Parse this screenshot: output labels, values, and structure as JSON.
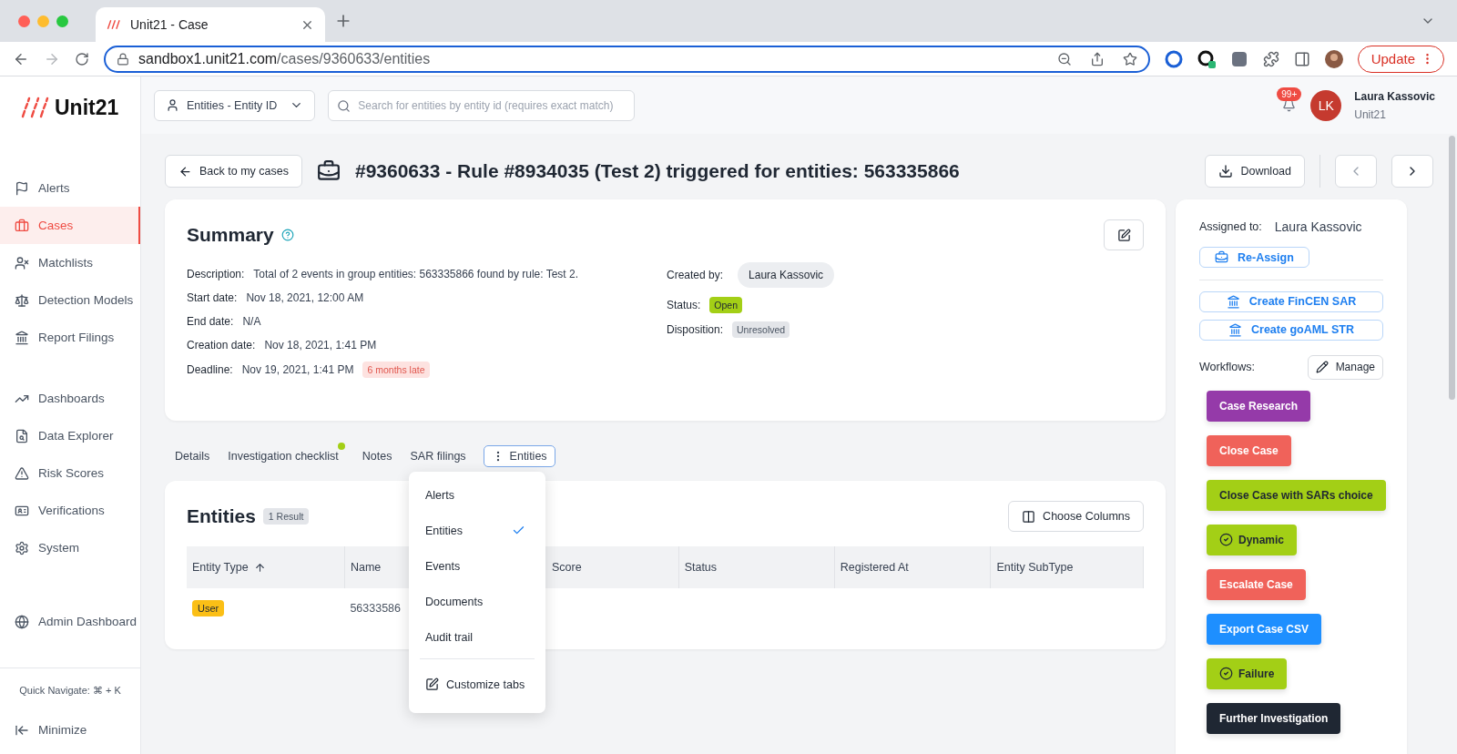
{
  "browser": {
    "tab_title": "Unit21 - Case",
    "url_host": "sandbox1.unit21.com",
    "url_path": "/cases/9360633/entities",
    "update_label": "Update"
  },
  "sidebar": {
    "logo": "Unit21",
    "groups": [
      [
        {
          "label": "Alerts",
          "selected": false
        },
        {
          "label": "Cases",
          "selected": true
        },
        {
          "label": "Matchlists",
          "selected": false
        },
        {
          "label": "Detection Models",
          "selected": false
        },
        {
          "label": "Report Filings",
          "selected": false
        }
      ],
      [
        {
          "label": "Dashboards",
          "selected": false
        },
        {
          "label": "Data Explorer",
          "selected": false
        },
        {
          "label": "Risk Scores",
          "selected": false
        },
        {
          "label": "Verifications",
          "selected": false
        },
        {
          "label": "System",
          "selected": false
        }
      ],
      [
        {
          "label": "Admin Dashboard",
          "selected": false
        }
      ]
    ],
    "quick_navigate": "Quick Navigate: ⌘ + K",
    "minimize": "Minimize"
  },
  "header": {
    "search_type": "Entities - Entity ID",
    "search_placeholder": "Search for entities by entity id (requires exact match)",
    "notifications": "99+",
    "user": {
      "initials": "LK",
      "name": "Laura Kassovic",
      "org": "Unit21"
    }
  },
  "page": {
    "back": "Back to my cases",
    "title": "#9360633 - Rule #8934035 (Test 2) triggered for entities: 563335866",
    "download": "Download"
  },
  "summary": {
    "title": "Summary",
    "left": [
      {
        "label": "Description:",
        "value": "Total of 2 events in group entities: 563335866 found by rule: Test 2."
      },
      {
        "label": "Start date:",
        "value": "Nov 18, 2021, 12:00 AM"
      },
      {
        "label": "End date:",
        "value": "N/A"
      },
      {
        "label": "Creation date:",
        "value": "Nov 18, 2021, 1:41 PM"
      },
      {
        "label": "Deadline:",
        "value": "Nov 19, 2021, 1:41 PM",
        "tag": "6 months late"
      }
    ],
    "right": [
      {
        "label": "Created by:",
        "value": "Laura Kassovic",
        "kind": "chip"
      },
      {
        "label": "Status:",
        "value": "Open",
        "kind": "status"
      },
      {
        "label": "Disposition:",
        "value": "Unresolved",
        "kind": "neutral"
      }
    ]
  },
  "tabs": [
    {
      "label": "Details",
      "selected": false,
      "dot": false
    },
    {
      "label": "Investigation checklist",
      "selected": false,
      "dot": true
    },
    {
      "label": "Notes",
      "selected": false,
      "dot": false
    },
    {
      "label": "SAR filings",
      "selected": false,
      "dot": false
    },
    {
      "label": "Entities",
      "selected": true,
      "dot": false
    }
  ],
  "tab_menu": {
    "items": [
      {
        "label": "Alerts",
        "checked": false
      },
      {
        "label": "Entities",
        "checked": true
      },
      {
        "label": "Events",
        "checked": false
      },
      {
        "label": "Documents",
        "checked": false
      },
      {
        "label": "Audit trail",
        "checked": false
      }
    ],
    "customize": "Customize tabs"
  },
  "entities": {
    "title": "Entities",
    "count": "1 Result",
    "choose_columns": "Choose Columns",
    "columns": [
      {
        "label": "Entity Type",
        "sorted": true
      },
      {
        "label": "Name",
        "sorted": false
      },
      {
        "label": "Score",
        "sorted": false
      },
      {
        "label": "Status",
        "sorted": false
      },
      {
        "label": "Registered At",
        "sorted": false
      },
      {
        "label": "Entity SubType",
        "sorted": false
      }
    ],
    "rows": [
      {
        "type": "User",
        "name": "56333586"
      }
    ]
  },
  "panel": {
    "assigned_label": "Assigned to:",
    "assigned_to": "Laura Kassovic",
    "reassign": "Re-Assign",
    "actions": [
      "Create FinCEN SAR",
      "Create goAML STR"
    ],
    "workflows_label": "Workflows:",
    "manage": "Manage",
    "workflows": [
      {
        "label": "Case Research",
        "color": "#953aa9",
        "kind": "plain"
      },
      {
        "label": "Close Case",
        "color": "#f0625a",
        "kind": "plain"
      },
      {
        "label": "Close Case with SARs choice",
        "color": "#a3cf16",
        "kind": "plain"
      },
      {
        "label": "Dynamic",
        "color": "#a3cf16",
        "kind": "check"
      },
      {
        "label": "Escalate Case",
        "color": "#f0625a",
        "kind": "plain"
      },
      {
        "label": "Export Case CSV",
        "color": "#1e8fff",
        "kind": "plain"
      },
      {
        "label": "Failure",
        "color": "#a3cf16",
        "kind": "check"
      },
      {
        "label": "Further Investigation",
        "color": "#1f2733",
        "kind": "plain"
      }
    ]
  }
}
